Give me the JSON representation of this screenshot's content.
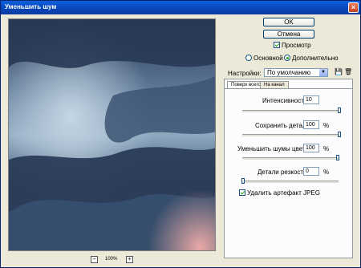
{
  "window": {
    "title": "Уменьшить шум",
    "close_icon": "close-icon"
  },
  "buttons": {
    "ok": "OK",
    "cancel": "Отмена"
  },
  "preview_toggle": {
    "label": "Просмотр",
    "checked": true
  },
  "mode": {
    "basic": "Основной",
    "advanced": "Дополнительно",
    "selected": "advanced"
  },
  "settings": {
    "label": "Настройки:",
    "value": "По умолчанию"
  },
  "tabs": [
    {
      "label": "Поверх всего",
      "active": true
    },
    {
      "label": "На канал",
      "active": false
    }
  ],
  "params": {
    "strength": {
      "label": "Интенсивность:",
      "value": "10",
      "level": 1.0
    },
    "preserve_details": {
      "label": "Сохранить детали:",
      "value": "100",
      "unit": "%",
      "level": 1.0
    },
    "reduce_color_noise": {
      "label": "Уменьшить шумы цветов:",
      "value": "100",
      "unit": "%",
      "level": 1.0
    },
    "sharpen_details": {
      "label": "Детали резкости:",
      "value": "0",
      "unit": "%",
      "level": 0.0
    }
  },
  "jpeg_artifact": {
    "label": "Удалить артефакт JPEG",
    "checked": true
  },
  "zoom": {
    "value": "100%",
    "minus": "−",
    "plus": "+"
  }
}
